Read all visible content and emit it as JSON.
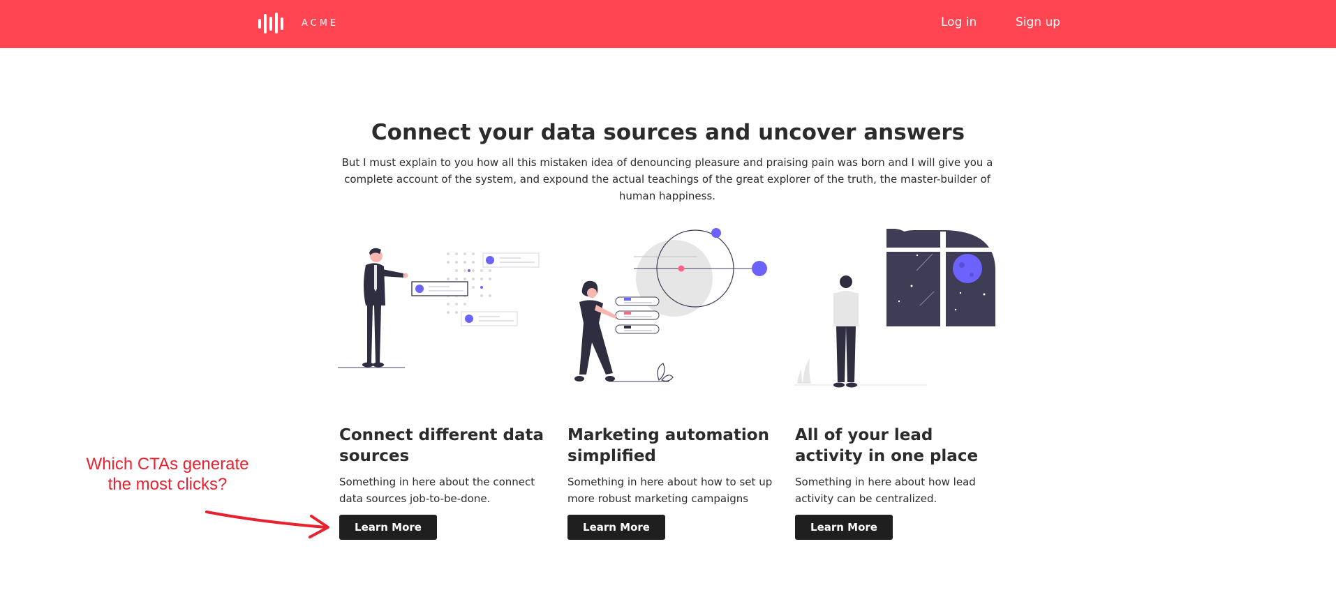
{
  "header": {
    "brand": "ACME",
    "login_label": "Log in",
    "signup_label": "Sign up"
  },
  "hero": {
    "title": "Connect your data sources and uncover answers",
    "body": "But I must explain to you how all this mistaken idea of denouncing pleasure and praising pain was born and I will give you a complete account of the system, and expound the actual teachings of the great explorer of the truth, the master-builder of human happiness."
  },
  "features": [
    {
      "title": "Connect different data sources",
      "text": "Something in here about the connect data sources job-to-be-done.",
      "cta": "Learn More"
    },
    {
      "title": "Marketing automation simplified",
      "text": "Something in here about how to set up more robust marketing campaigns",
      "cta": "Learn More"
    },
    {
      "title": "All of your lead activity in one place",
      "text": "Something in here about how lead activity can be centralized.",
      "cta": "Learn More"
    }
  ],
  "annotation": {
    "text": "Which CTAs generate the most clicks?"
  },
  "colors": {
    "brand_red": "#ff4551",
    "accent_purple": "#6c63ff",
    "dark_figure": "#2f2e41",
    "cta_bg": "#1f1f1f",
    "annotation_red": "#e8212f"
  },
  "icons": {
    "logo": "soundwave-bars-icon"
  }
}
